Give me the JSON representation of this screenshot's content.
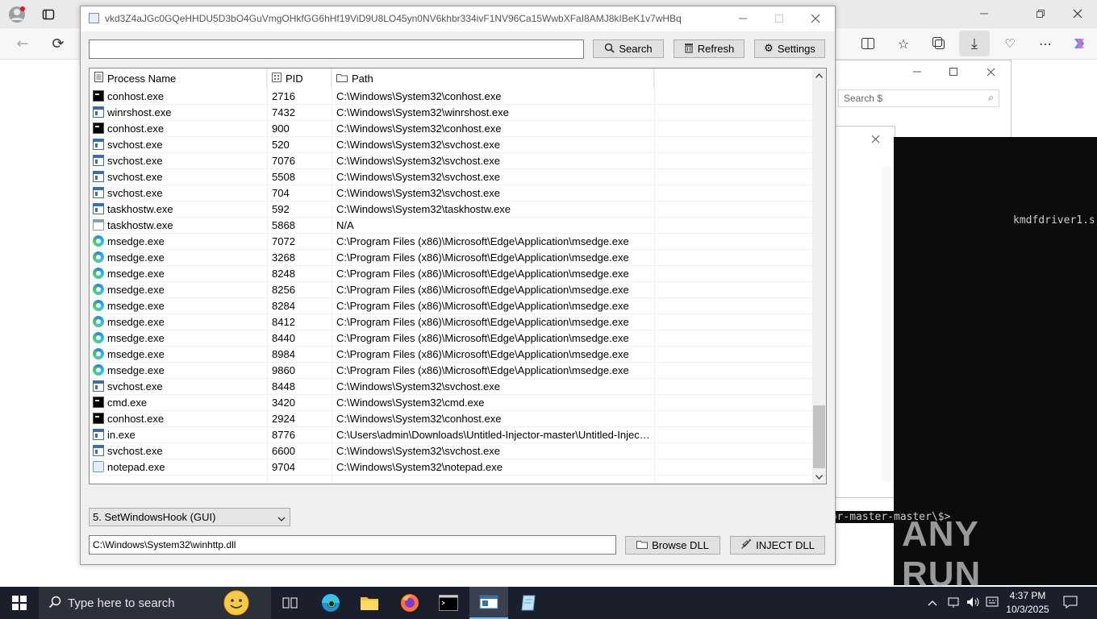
{
  "window": {
    "title": "vkd3Z4aJGc0GQeHHDU5D3bO4GuVmgOHkfGG6hHf19ViD9U8LO45yn0NV6khbr334ivF1NV96Ca15WwbXFaI8AMJ8kIBeK1v7wHBq"
  },
  "toolbar": {
    "search_value": "",
    "search_label": "Search",
    "refresh_label": "Refresh",
    "settings_label": "Settings"
  },
  "list": {
    "columns": [
      "Process Name",
      "PID",
      "Path"
    ],
    "rows": [
      {
        "icon": "console",
        "name": "conhost.exe",
        "pid": "2716",
        "path": "C:\\Windows\\System32\\conhost.exe"
      },
      {
        "icon": "window",
        "name": "winrshost.exe",
        "pid": "7432",
        "path": "C:\\Windows\\System32\\winrshost.exe"
      },
      {
        "icon": "console",
        "name": "conhost.exe",
        "pid": "900",
        "path": "C:\\Windows\\System32\\conhost.exe"
      },
      {
        "icon": "window",
        "name": "svchost.exe",
        "pid": "520",
        "path": "C:\\Windows\\System32\\svchost.exe"
      },
      {
        "icon": "window",
        "name": "svchost.exe",
        "pid": "7076",
        "path": "C:\\Windows\\System32\\svchost.exe"
      },
      {
        "icon": "window",
        "name": "svchost.exe",
        "pid": "5508",
        "path": "C:\\Windows\\System32\\svchost.exe"
      },
      {
        "icon": "window",
        "name": "svchost.exe",
        "pid": "704",
        "path": "C:\\Windows\\System32\\svchost.exe"
      },
      {
        "icon": "window",
        "name": "taskhostw.exe",
        "pid": "592",
        "path": "C:\\Windows\\System32\\taskhostw.exe"
      },
      {
        "icon": "window-gray",
        "name": "taskhostw.exe",
        "pid": "5868",
        "path": "N/A"
      },
      {
        "icon": "edge",
        "name": "msedge.exe",
        "pid": "7072",
        "path": "C:\\Program Files (x86)\\Microsoft\\Edge\\Application\\msedge.exe"
      },
      {
        "icon": "edge",
        "name": "msedge.exe",
        "pid": "3268",
        "path": "C:\\Program Files (x86)\\Microsoft\\Edge\\Application\\msedge.exe"
      },
      {
        "icon": "edge",
        "name": "msedge.exe",
        "pid": "8248",
        "path": "C:\\Program Files (x86)\\Microsoft\\Edge\\Application\\msedge.exe"
      },
      {
        "icon": "edge",
        "name": "msedge.exe",
        "pid": "8256",
        "path": "C:\\Program Files (x86)\\Microsoft\\Edge\\Application\\msedge.exe"
      },
      {
        "icon": "edge",
        "name": "msedge.exe",
        "pid": "8284",
        "path": "C:\\Program Files (x86)\\Microsoft\\Edge\\Application\\msedge.exe"
      },
      {
        "icon": "edge",
        "name": "msedge.exe",
        "pid": "8412",
        "path": "C:\\Program Files (x86)\\Microsoft\\Edge\\Application\\msedge.exe"
      },
      {
        "icon": "edge",
        "name": "msedge.exe",
        "pid": "8440",
        "path": "C:\\Program Files (x86)\\Microsoft\\Edge\\Application\\msedge.exe"
      },
      {
        "icon": "edge",
        "name": "msedge.exe",
        "pid": "8984",
        "path": "C:\\Program Files (x86)\\Microsoft\\Edge\\Application\\msedge.exe"
      },
      {
        "icon": "edge",
        "name": "msedge.exe",
        "pid": "9860",
        "path": "C:\\Program Files (x86)\\Microsoft\\Edge\\Application\\msedge.exe"
      },
      {
        "icon": "window",
        "name": "svchost.exe",
        "pid": "8448",
        "path": "C:\\Windows\\System32\\svchost.exe"
      },
      {
        "icon": "console",
        "name": "cmd.exe",
        "pid": "3420",
        "path": "C:\\Windows\\System32\\cmd.exe"
      },
      {
        "icon": "console",
        "name": "conhost.exe",
        "pid": "2924",
        "path": "C:\\Windows\\System32\\conhost.exe"
      },
      {
        "icon": "window",
        "name": "in.exe",
        "pid": "8776",
        "path": "C:\\Users\\admin\\Downloads\\Untitled-Injector-master\\Untitled-Injec…"
      },
      {
        "icon": "window",
        "name": "svchost.exe",
        "pid": "6600",
        "path": "C:\\Windows\\System32\\svchost.exe"
      },
      {
        "icon": "notepad",
        "name": "notepad.exe",
        "pid": "9704",
        "path": "C:\\Windows\\System32\\notepad.exe"
      }
    ]
  },
  "inject": {
    "method_selected": "5. SetWindowsHook (GUI)",
    "dll_path": "C:\\Windows\\System32\\winhttp.dll",
    "browse_label": "Browse DLL",
    "inject_label": "INJECT DLL"
  },
  "background": {
    "explorer_search_placeholder": "Search $",
    "console_line1": "kmdfdriver1.s",
    "console_line2": "-Injector-master\\$>"
  },
  "watermark": "ANY RUN",
  "taskbar": {
    "search_placeholder": "Type here to search",
    "time": "4:37 PM",
    "date": "10/3/2025"
  },
  "colors": {
    "taskbar_bg": "#1a1f2b",
    "accent": "#0078d4"
  }
}
